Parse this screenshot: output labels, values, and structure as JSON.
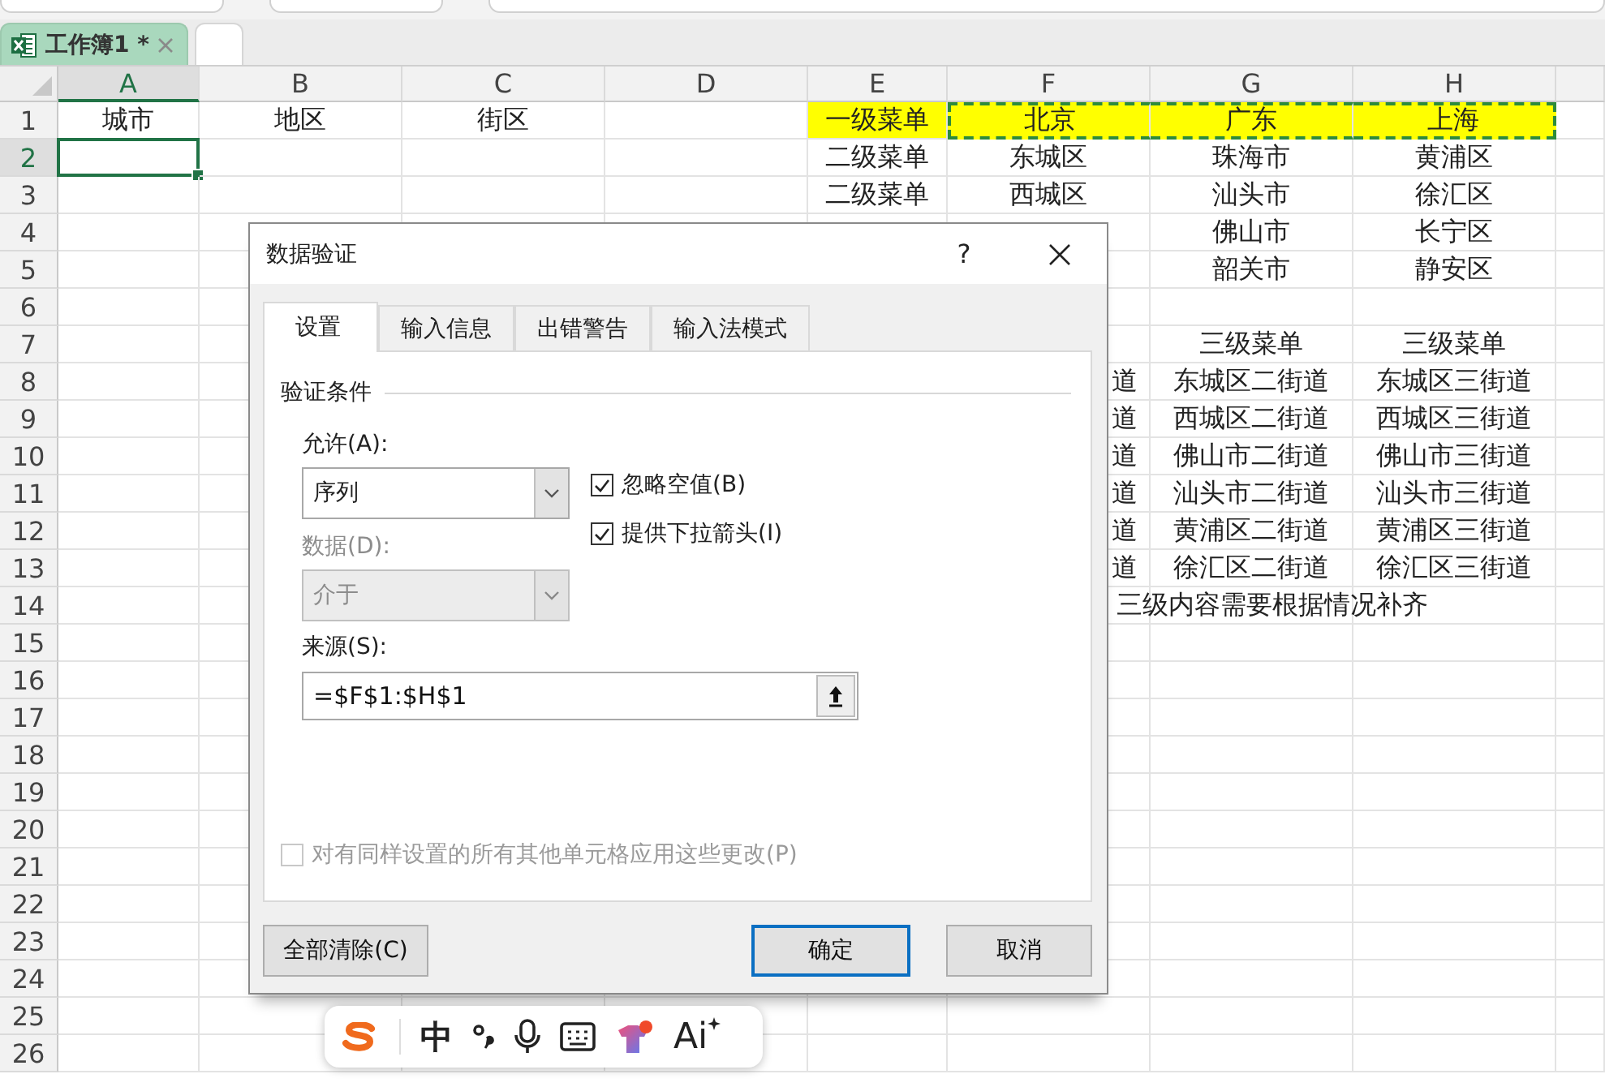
{
  "workbook_tabs": [
    {
      "label": "工作簿1 *",
      "selected": true
    },
    {
      "selected": false
    }
  ],
  "sheet": {
    "columns": [
      {
        "label": "A",
        "selected": true
      },
      {
        "label": "B",
        "selected": false
      },
      {
        "label": "C",
        "selected": false
      },
      {
        "label": "D",
        "selected": false
      },
      {
        "label": "E",
        "selected": false
      },
      {
        "label": "F",
        "selected": false
      },
      {
        "label": "G",
        "selected": false
      },
      {
        "label": "H",
        "selected": false
      }
    ],
    "rows": [
      {
        "number": "1",
        "selected": false,
        "cells": [
          "城市",
          "地区",
          "街区",
          "",
          {
            "text": "一级菜单",
            "color": "#ffff00"
          },
          {
            "text": "北京",
            "color": "#ffff00",
            "copied": true
          },
          {
            "text": "广东",
            "color": "#ffff00",
            "copied": true
          },
          {
            "text": "上海",
            "color": "#ffff00",
            "copied": true
          }
        ]
      },
      {
        "number": "2",
        "selected": true,
        "cells": [
          "",
          "",
          "",
          "",
          "二级菜单",
          "东城区",
          "珠海市",
          "黄浦区"
        ]
      },
      {
        "number": "3",
        "selected": false,
        "cells": [
          "",
          "",
          "",
          "",
          "二级菜单",
          "西城区",
          "汕头市",
          "徐汇区"
        ]
      },
      {
        "number": "4",
        "selected": false,
        "cells": [
          "",
          "",
          "",
          "",
          "",
          "",
          "佛山市",
          "长宁区"
        ]
      },
      {
        "number": "5",
        "selected": false,
        "cells": [
          "",
          "",
          "",
          "",
          "",
          "",
          "韶关市",
          "静安区"
        ]
      },
      {
        "number": "6",
        "selected": false,
        "cells": []
      },
      {
        "number": "7",
        "selected": false,
        "cells": [
          "",
          "",
          "",
          "",
          "",
          "",
          "三级菜单",
          "三级菜单"
        ]
      },
      {
        "number": "8",
        "selected": false,
        "cells": [
          "",
          "",
          "",
          "",
          "",
          {
            "text": "道",
            "kind": "cut"
          },
          "东城区二街道",
          "东城区三街道"
        ]
      },
      {
        "number": "9",
        "selected": false,
        "cells": [
          "",
          "",
          "",
          "",
          "",
          {
            "text": "道",
            "kind": "cut"
          },
          "西城区二街道",
          "西城区三街道"
        ]
      },
      {
        "number": "10",
        "selected": false,
        "cells": [
          "",
          "",
          "",
          "",
          "",
          {
            "text": "道",
            "kind": "cut"
          },
          "佛山市二街道",
          "佛山市三街道"
        ]
      },
      {
        "number": "11",
        "selected": false,
        "cells": [
          "",
          "",
          "",
          "",
          "",
          {
            "text": "道",
            "kind": "cut"
          },
          "汕头市二街道",
          "汕头市三街道"
        ]
      },
      {
        "number": "12",
        "selected": false,
        "cells": [
          "",
          "",
          "",
          "",
          "",
          {
            "text": "道",
            "kind": "cut"
          },
          "黄浦区二街道",
          "黄浦区三街道"
        ]
      },
      {
        "number": "13",
        "selected": false,
        "cells": [
          "",
          "",
          "",
          "",
          "",
          {
            "text": "道",
            "kind": "cut"
          },
          "徐汇区二街道",
          "徐汇区三街道"
        ]
      },
      {
        "number": "14",
        "selected": false,
        "cells": [
          "",
          "",
          "",
          "",
          "",
          {
            "text": "三级内容需要根据情况补齐",
            "kind": "overflow"
          }
        ]
      },
      {
        "number": "15",
        "selected": false,
        "cells": []
      },
      {
        "number": "16",
        "selected": false,
        "cells": []
      },
      {
        "number": "17",
        "selected": false,
        "cells": []
      },
      {
        "number": "18",
        "selected": false,
        "cells": []
      },
      {
        "number": "19",
        "selected": false,
        "cells": []
      },
      {
        "number": "20",
        "selected": false,
        "cells": []
      },
      {
        "number": "21",
        "selected": false,
        "cells": []
      },
      {
        "number": "22",
        "selected": false,
        "cells": []
      },
      {
        "number": "23",
        "selected": false,
        "cells": []
      },
      {
        "number": "24",
        "selected": false,
        "cells": []
      },
      {
        "number": "25",
        "selected": false,
        "cells": []
      },
      {
        "number": "26",
        "selected": false,
        "cells": []
      }
    ]
  },
  "dialog": {
    "title": "数据验证",
    "help": "?",
    "tabs": [
      {
        "label": "设置",
        "selected": true
      },
      {
        "label": "输入信息",
        "selected": false
      },
      {
        "label": "出错警告",
        "selected": false
      },
      {
        "label": "输入法模式",
        "selected": false
      }
    ],
    "group_label": "验证条件",
    "allow": {
      "label": "允许(A):",
      "value": "序列",
      "disabled": false
    },
    "data": {
      "label": "数据(D):",
      "value": "介于",
      "disabled": true
    },
    "checkboxes": [
      {
        "label": "忽略空值(B)",
        "checked": true
      },
      {
        "label": "提供下拉箭头(I)",
        "checked": true
      }
    ],
    "source": {
      "label": "来源(S):",
      "value": "=$F$1:$H$1"
    },
    "apply_all": {
      "label": "对有同样设置的所有其他单元格应用这些更改(P)",
      "checked": false,
      "disabled": true
    },
    "buttons": [
      {
        "label": "全部清除(C)",
        "default": false
      },
      {
        "label": "确定",
        "default": true
      },
      {
        "label": "取消",
        "default": false
      }
    ]
  },
  "ime_toolbar": {
    "items": [
      {
        "kind": "logo"
      },
      {
        "kind": "text",
        "label": "中"
      },
      {
        "kind": "punctuation"
      },
      {
        "kind": "mic"
      },
      {
        "kind": "keyboard"
      },
      {
        "kind": "skin"
      },
      {
        "kind": "ai",
        "label": "Ai"
      }
    ]
  }
}
